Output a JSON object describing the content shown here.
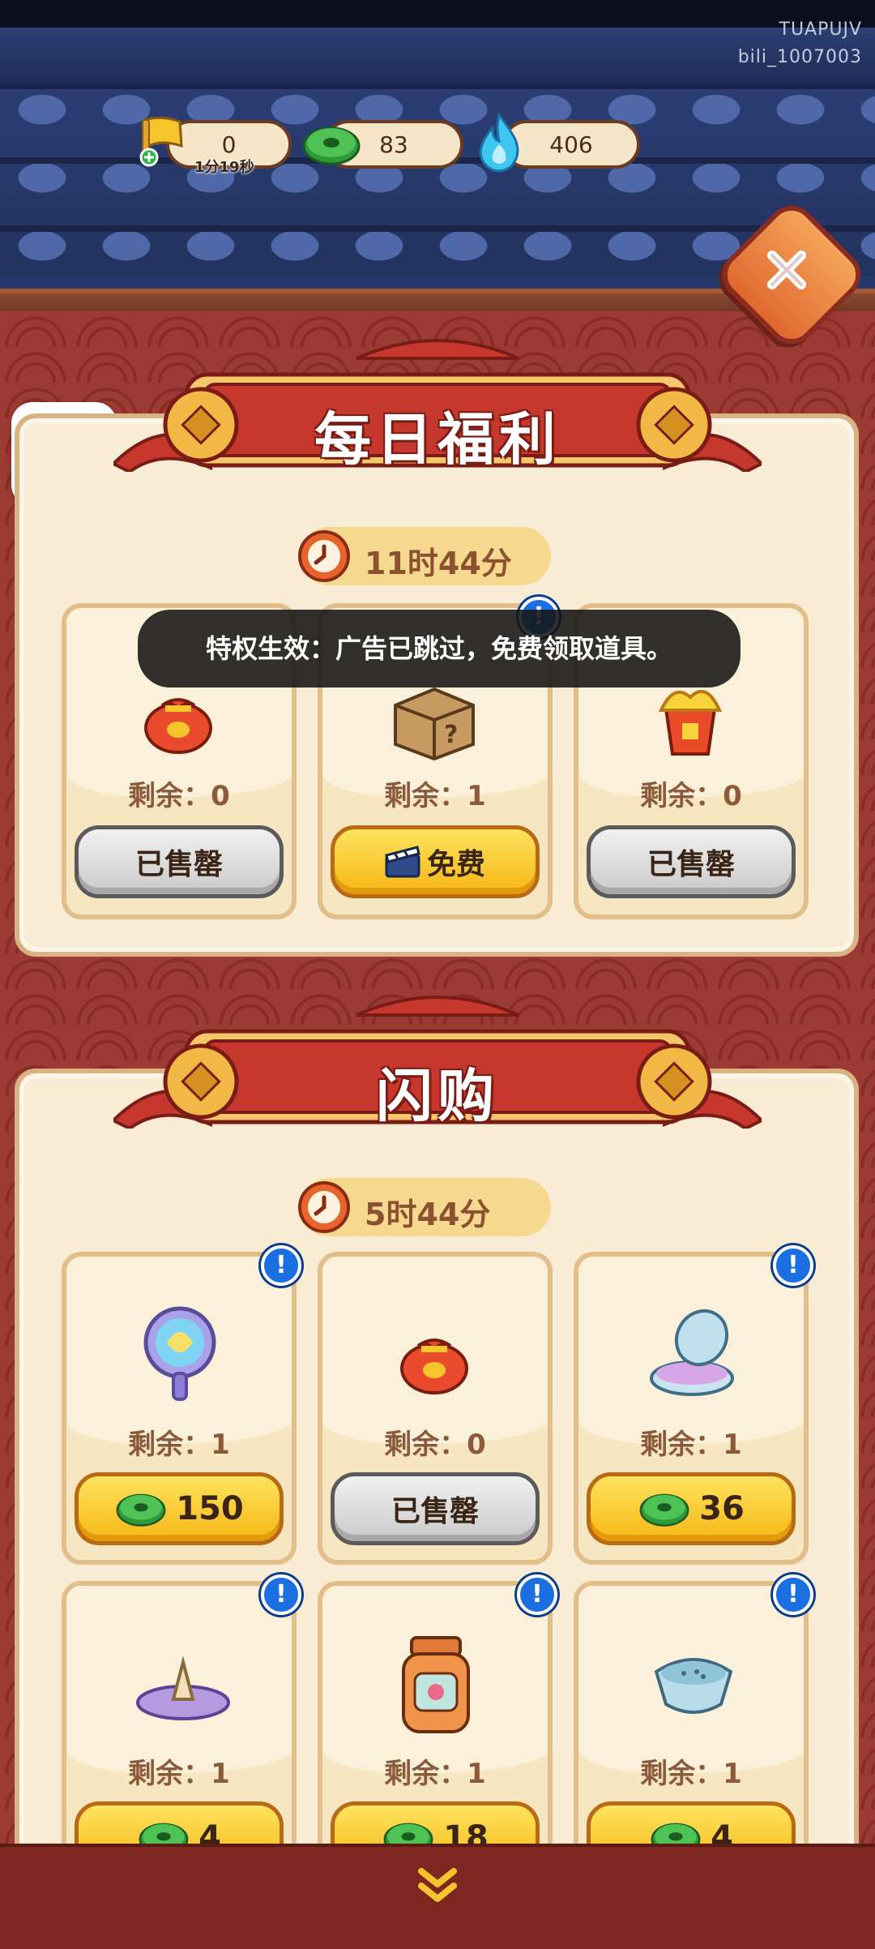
{
  "watermark": {
    "line1": "TUAPUJV",
    "line2": "bili_1007003"
  },
  "resources": {
    "stamina": {
      "value": "0",
      "timer": "1分19秒",
      "icon": "yellow-flag-icon"
    },
    "coins": {
      "value": "83",
      "icon": "green-coin-icon"
    },
    "fire": {
      "value": "406",
      "icon": "blue-flame-icon"
    }
  },
  "bili_logo": "bilibili",
  "daily": {
    "title": "每日福利",
    "timer": "11时44分",
    "toast": "特权生效：广告已跳过，免费领取道具。",
    "items": [
      {
        "icon": "red-pouch-icon",
        "remain": "剩余：0",
        "button": "已售罄",
        "style": "gray"
      },
      {
        "icon": "mystery-box-icon",
        "remain": "剩余：1",
        "button": "免费",
        "style": "yellow-video"
      },
      {
        "icon": "gold-bucket-icon",
        "remain": "剩余：0",
        "button": "已售罄",
        "style": "gray"
      }
    ]
  },
  "flash": {
    "title": "闪购",
    "timer": "5时44分",
    "items": [
      {
        "icon": "magic-mirror-icon",
        "remain": "剩余：1",
        "price": "150"
      },
      {
        "icon": "red-pouch-icon",
        "remain": "剩余：0",
        "button": "已售罄"
      },
      {
        "icon": "compact-case-icon",
        "remain": "剩余：1",
        "price": "36"
      },
      {
        "icon": "incense-cone-icon",
        "remain": "剩余：1",
        "price": "4"
      },
      {
        "icon": "jar-icon",
        "remain": "剩余：1",
        "price": "18"
      },
      {
        "icon": "bowl-icon",
        "remain": "剩余：1",
        "price": "4"
      }
    ]
  },
  "colors": {
    "accent": "#f6b716",
    "panel": "#f8ecd4",
    "banner": "#c6372d"
  }
}
